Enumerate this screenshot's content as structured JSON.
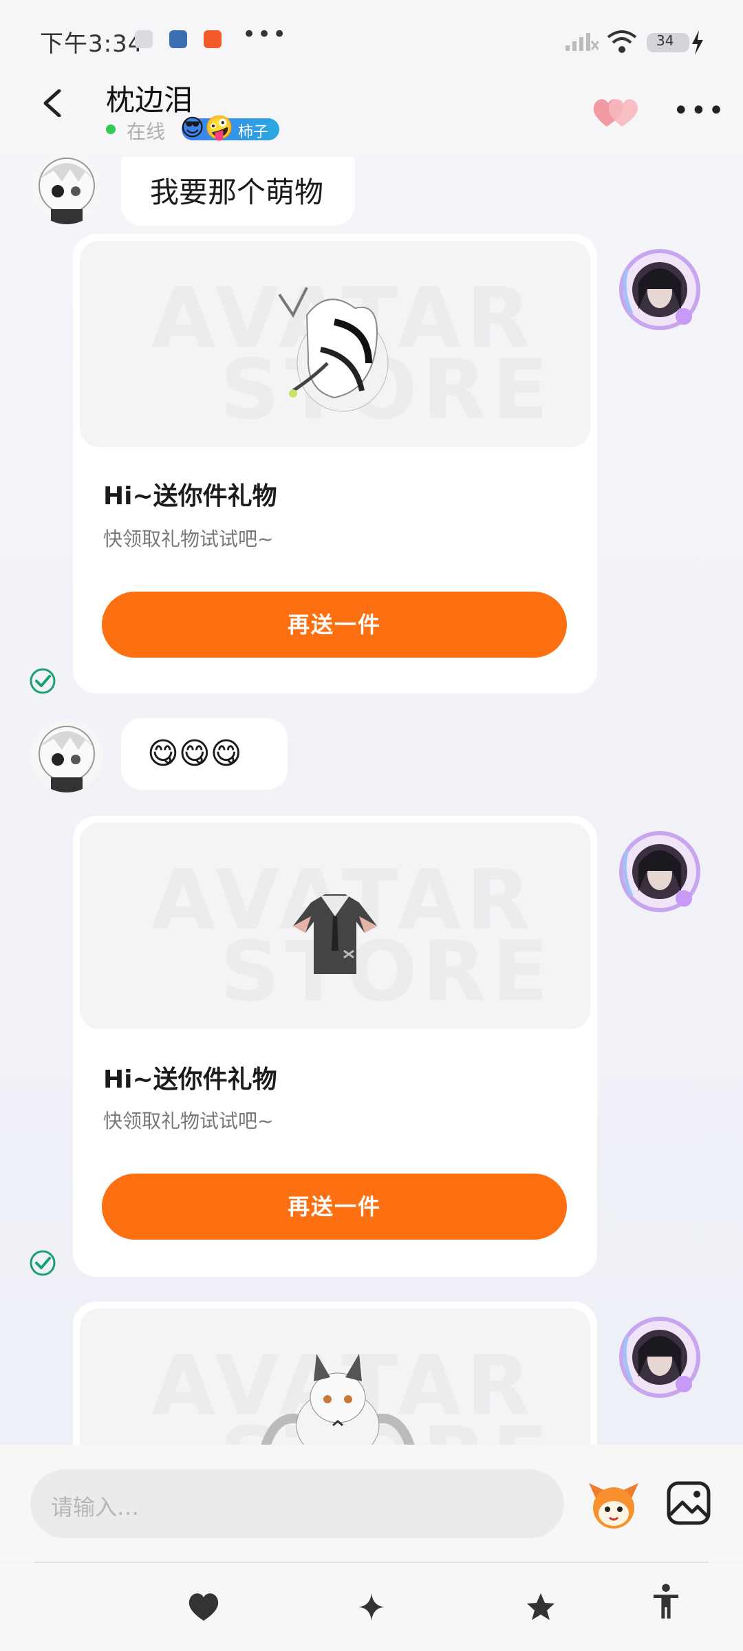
{
  "status": {
    "time": "下午3:34",
    "battery": "34",
    "more": "•••"
  },
  "header": {
    "title": "枕边泪",
    "status": "在线",
    "badge_emoji": "😎🤪",
    "badge_text": "柿子",
    "more": "•••"
  },
  "messages": {
    "first_text": "我要那个萌物",
    "emoji_text": "😋😋😋"
  },
  "cards": [
    {
      "title": "Hi~送你件礼物",
      "subtitle": "快领取礼物试试吧~",
      "button": "再送一件",
      "watermark_1": "AVATAR",
      "watermark_2": "STORE"
    },
    {
      "title": "Hi~送你件礼物",
      "subtitle": "快领取礼物试试吧~",
      "button": "再送一件",
      "watermark_1": "AVATAR",
      "watermark_2": "STORE"
    },
    {
      "watermark_1": "AVATAR",
      "watermark_2": "STORE"
    }
  ],
  "input": {
    "placeholder": "请输入…"
  },
  "colors": {
    "accent": "#fd7012",
    "online": "#2ecc52",
    "check": "#19a06f"
  },
  "icons": [
    "heart-icon",
    "sparkle-icon",
    "star-icon",
    "accessibility-icon",
    "image-icon",
    "back-icon",
    "more-icon"
  ]
}
